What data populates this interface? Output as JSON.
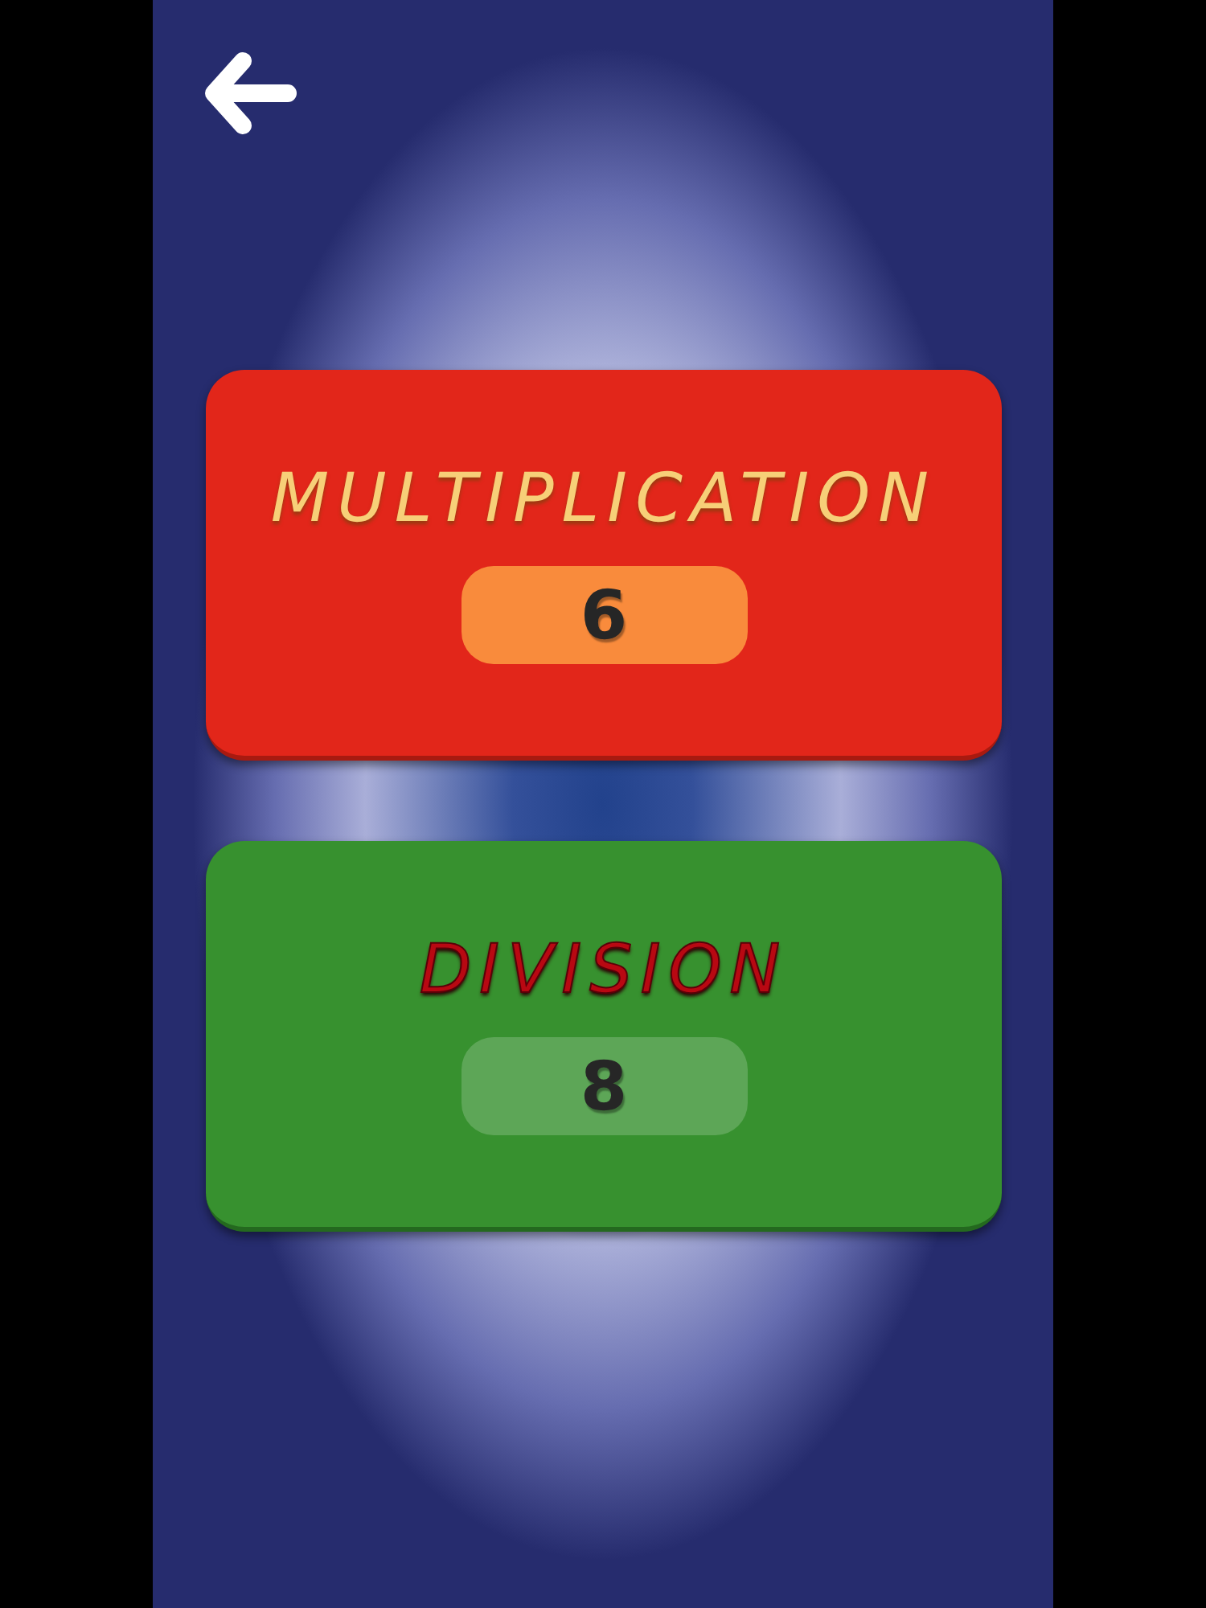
{
  "cards": [
    {
      "title": "MULTIPLICATION",
      "value": "6",
      "color": "#e2261a"
    },
    {
      "title": "DIVISION",
      "value": "8",
      "color": "#37912f"
    }
  ]
}
